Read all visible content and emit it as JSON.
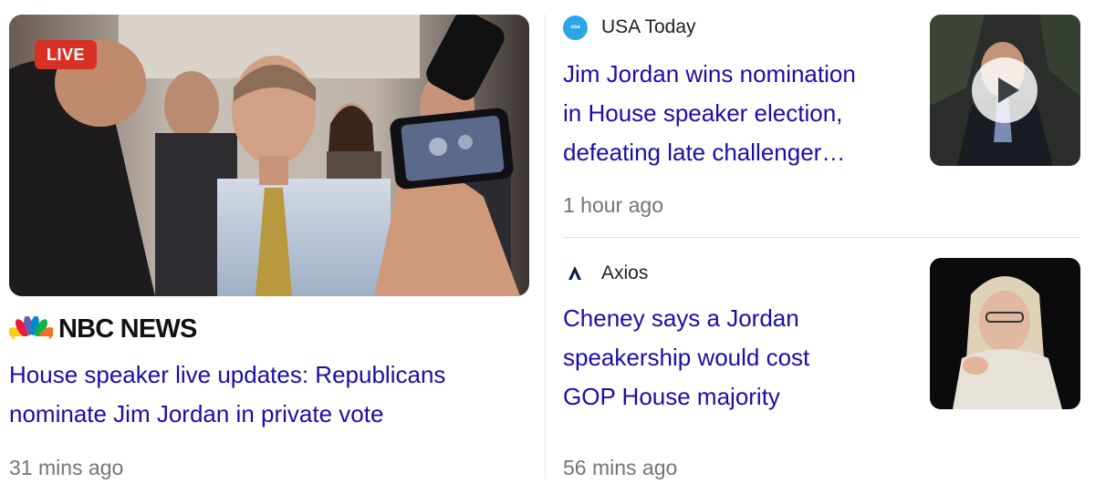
{
  "main_story": {
    "badge": "LIVE",
    "source": "NBC NEWS",
    "headline_line1": "House speaker live updates: Republicans",
    "headline_line2": "nominate Jim Jordan in private vote",
    "time": "31 mins ago",
    "image_icon": "press-scrum-photo"
  },
  "story_2": {
    "source": "USA Today",
    "logo_icon": "usa-today-logo-icon",
    "headline_line1": "Jim Jordan wins nomination",
    "headline_line2": "in House speaker election,",
    "headline_line3": "defeating late challenger…",
    "time": "1 hour ago",
    "thumb_icon": "video-play-icon"
  },
  "story_3": {
    "source": "Axios",
    "logo_icon": "axios-logo-icon",
    "headline_line1": "Cheney says a Jordan",
    "headline_line2": "speakership would cost",
    "headline_line3": "GOP House majority",
    "time": "56 mins ago"
  },
  "colors": {
    "link": "#1a0dab",
    "live": "#d93025",
    "meta": "#70757a"
  }
}
